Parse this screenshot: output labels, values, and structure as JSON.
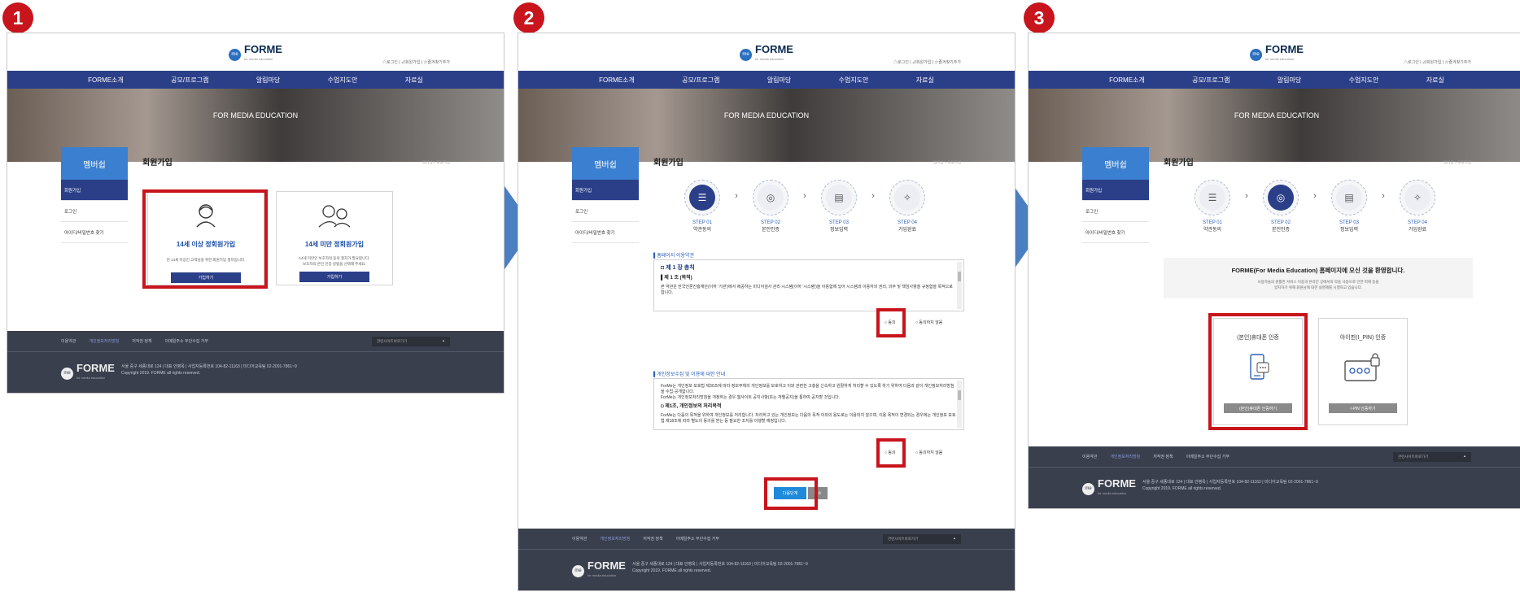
{
  "step_markers": [
    "1",
    "2",
    "3"
  ],
  "logo": {
    "name": "FORME",
    "tagline": "for media education"
  },
  "util_links": "△로그인 | ⊿회원가입 | ☆즐겨찾기추가",
  "nav": [
    "FORME소개",
    "공모/프로그램",
    "알림마당",
    "수업지도안",
    "자료실"
  ],
  "hero_text": "FOR MEDIA EDUCATION",
  "sidebar": {
    "title": "멤버쉽",
    "items": [
      "회원가입",
      "로그인",
      "아이디/비밀번호 찾기"
    ]
  },
  "content_title": "회원가입",
  "breadcrumb": "멤버십 > 회원가입",
  "panel1": {
    "card_adult": {
      "title": "14세 이상 정회원가입",
      "desc": "만 14세 이상인 고객님을 위한 회원가입 절차입니다.",
      "button": "가입하기"
    },
    "card_minor": {
      "title": "14세 미만 정회원가입",
      "desc1": "14세 미만인 보호자의 동의 절차가 필요합니다.",
      "desc2": "보호자의 본인 인증 방법을 선택해 주세요.",
      "button": "가입하기"
    }
  },
  "steps": [
    {
      "num": "STEP 01",
      "label": "약관동의",
      "icon": "☰"
    },
    {
      "num": "STEP 02",
      "label": "본인인증",
      "icon": "◎"
    },
    {
      "num": "STEP 03",
      "label": "정보입력",
      "icon": "▤"
    },
    {
      "num": "STEP 04",
      "label": "가입완료",
      "icon": "✧"
    }
  ],
  "panel2": {
    "terms_section": "홈페이지 이용약관",
    "terms_heading": "제 1 장 총칙",
    "terms_article": "제 1 조 (목적)",
    "terms_body": "본 약관은 한국언론진흥재단(이하 '기관')에서 제공하는 미디어검사 관리 시스템(이하 '시스템')을 이용함에 있어 시스템과 이용자의 권리, 의무 및 책임사항을 규정함을 목적으로 합니다.",
    "privacy_section": "개인정보수집 및 이용에 대한 안내",
    "privacy_body1": "ForMe는 개인정보 보호법 제30조에 따라 정보주체의 개인정보를 보호하고 이와 관련한 고충을 신속하고 원활하게 처리할 수 있도록 하기 위하여 다음과 같이 개인정보처리방침을 수립·공개합니다.",
    "privacy_body2": "ForMe는 개인정보처리방침을 개정하는 경우 웹사이트 공지사항(또는 개별공지)을 통하여 공지할 것입니다.",
    "privacy_heading": "제1조, 개인정보의 처리목적",
    "privacy_body3": "ForMe는 다음의 목적을 위하여 개인정보를 처리합니다. 처리하고 있는 개인정보는 다음의 목적 이외의 용도로는 이용되지 않으며, 이용 목적이 변경되는 경우에는 개인정보 보호법 제18조에 따라 별도의 동의를 받는 등 필요한 조치를 이행할 예정입니다.",
    "agree": "동의",
    "disagree": "동의하지 않음",
    "next": "다음단계",
    "cancel": "취소"
  },
  "panel3": {
    "welcome_title": "FORME(For Media Education) 홈페이지에 오신 것을 환영합니다.",
    "welcome_desc1": "사용자들의 원활한 서비스 이용과 온라인 상에서의 악용 사용으로 인한 피해 등을",
    "welcome_desc2": "방지하기 위해 회원님에 대한 실명제를 시행하고 있습니다.",
    "phone_title": "(본인)휴대폰 인증",
    "phone_button": "(본인)휴대폰 인증하기",
    "ipin_title": "아이핀(I_PIN) 인증",
    "ipin_button": "I-PIN 인증하기"
  },
  "footer": {
    "links": [
      "이용약관",
      "개인정보처리방침",
      "저작권 정책",
      "이메일주소 무단수집 거부"
    ],
    "family_site": "관련사이트바로가기",
    "address": "서울 중구 세종대로 124  |  대표 안병옥  |  사업자등록번호 104-82-11163  |  미디어교육팀 02-2001-7861~9",
    "copyright": "Copyright 2019. FORME all rights reserved."
  },
  "colors": {
    "brand_nav": "#2b3f88",
    "accent_red": "#c8141c",
    "flow_arrow": "#4a7fc1",
    "footer": "#3a3f4d"
  }
}
